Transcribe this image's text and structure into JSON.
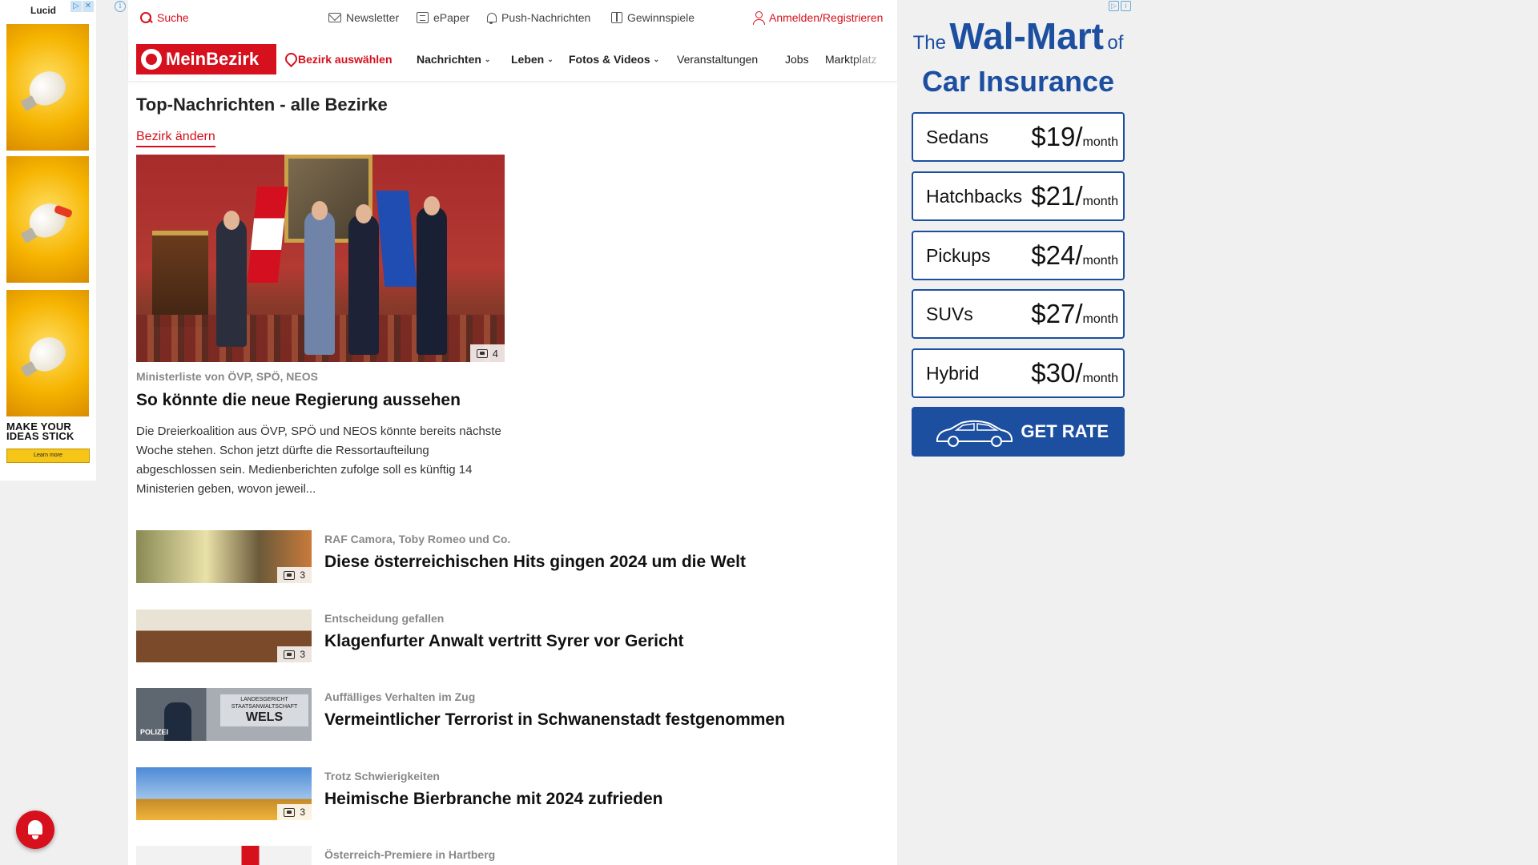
{
  "left_ad": {
    "brand": "Lucid",
    "slogan": "MAKE YOUR IDEAS STICK",
    "cta": "Learn more"
  },
  "topbar": {
    "search": "Suche",
    "newsletter": "Newsletter",
    "epaper": "ePaper",
    "push": "Push-Nachrichten",
    "contests": "Gewinnspiele",
    "login": "Anmelden/Registrieren"
  },
  "nav": {
    "logo": "MeinBezirk",
    "select_district": "Bezirk auswählen",
    "items": [
      "Nachrichten",
      "Leben",
      "Fotos & Videos",
      "Veranstaltungen",
      "Jobs",
      "Marktplatz"
    ]
  },
  "page": {
    "title": "Top-Nachrichten - alle Bezirke",
    "change_district": "Bezirk ändern"
  },
  "hero": {
    "image_count": "4",
    "kicker": "Ministerliste von ÖVP, SPÖ, NEOS",
    "title": "So könnte die neue Regierung aussehen",
    "text": "Die Dreierkoalition aus ÖVP, SPÖ und NEOS könnte bereits nächste Woche stehen. Schon jetzt dürfte die Ressortaufteilung abgeschlossen sein. Medienberichten zufolge soll es künftig 14 Ministerien geben, wovon jeweil..."
  },
  "teasers": [
    {
      "kicker": "RAF Camora, Toby Romeo und Co.",
      "title": "Diese österreichischen Hits gingen 2024 um die Welt",
      "image_count": "3"
    },
    {
      "kicker": "Entscheidung gefallen",
      "title": "Klagenfurter Anwalt vertritt Syrer vor Gericht",
      "image_count": "3"
    },
    {
      "kicker": "Auffälliges Verhalten im Zug",
      "title": "Vermeintlicher Terrorist in Schwanenstadt festgenommen",
      "image_count": "",
      "sign_small": "LANDESGERICHT STAATSANWALTSCHAFT",
      "sign_big": "WELS",
      "badge_text": "POLIZEI"
    },
    {
      "kicker": "Trotz Schwierigkeiten",
      "title": "Heimische Bierbranche mit 2024 zufrieden",
      "image_count": "3"
    },
    {
      "kicker": "Österreich-Premiere in Hartberg",
      "title": "",
      "image_count": ""
    }
  ],
  "right_ad": {
    "the": "The",
    "brand": "Wal-Mart",
    "of": "of",
    "line2": "Car Insurance",
    "rates": [
      {
        "category": "Sedans",
        "price": "$19",
        "unit": "month"
      },
      {
        "category": "Hatchbacks",
        "price": "$21",
        "unit": "month"
      },
      {
        "category": "Pickups",
        "price": "$24",
        "unit": "month"
      },
      {
        "category": "SUVs",
        "price": "$27",
        "unit": "month"
      },
      {
        "category": "Hybrid",
        "price": "$30",
        "unit": "month"
      }
    ],
    "cta": "GET RATE"
  },
  "colors": {
    "brand_red": "#d6101c",
    "ad_blue": "#1d4fa1"
  }
}
